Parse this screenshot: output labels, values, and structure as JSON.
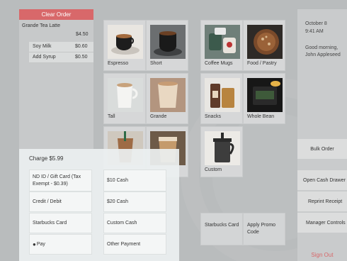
{
  "order": {
    "clear_label": "Clear Order",
    "item_name": "Grande Tea Latte",
    "item_price": "$4.50",
    "modifiers": [
      {
        "name": "Soy Milk",
        "price": "$0.60"
      },
      {
        "name": "Add Syrup",
        "price": "$0.50"
      }
    ]
  },
  "products": [
    {
      "label": "Espresso",
      "icon": "espresso-photo"
    },
    {
      "label": "Short",
      "icon": "short-coffee-photo"
    },
    {
      "label": "Coffee Mugs",
      "icon": "coffee-mugs-photo"
    },
    {
      "label": "Food / Pastry",
      "icon": "pastry-photo"
    },
    {
      "label": "Tall",
      "icon": "tall-coffee-photo"
    },
    {
      "label": "Grande",
      "icon": "grande-coffee-photo"
    },
    {
      "label": "Snacks",
      "icon": "snacks-photo"
    },
    {
      "label": "Whole Bean",
      "icon": "whole-bean-photo"
    },
    {
      "label": "",
      "icon": "iced-drink-photo"
    },
    {
      "label": "",
      "icon": "iced-drink-photo"
    },
    {
      "label": "Custom",
      "icon": "french-press-photo"
    }
  ],
  "actions": {
    "starbucks_card": "Starbucks Card",
    "apply_promo": "Apply Promo Code"
  },
  "sidebar": {
    "date": "October 8",
    "time": "9:41 AM",
    "greeting": "Good morning,",
    "user": "John Appleseed",
    "bulk_order": "Bulk Order",
    "open_cash_drawer": "Open Cash Drawer",
    "reprint_receipt": "Reprint Receipt",
    "manager_controls": "Manager Controls",
    "sign_out": "Sign Out"
  },
  "payment": {
    "charge": "Charge $5.99",
    "methods": [
      "ND ID / Gift Card (Tax Exempt - $0.39)",
      "$10 Cash",
      "Credit / Debit",
      "$20 Cash",
      "Starbucks Card",
      "Custom Cash",
      "Pay",
      "Other Payment"
    ]
  },
  "colors": {
    "accent_red": "#d8686a",
    "background": "#b9bcbd"
  }
}
